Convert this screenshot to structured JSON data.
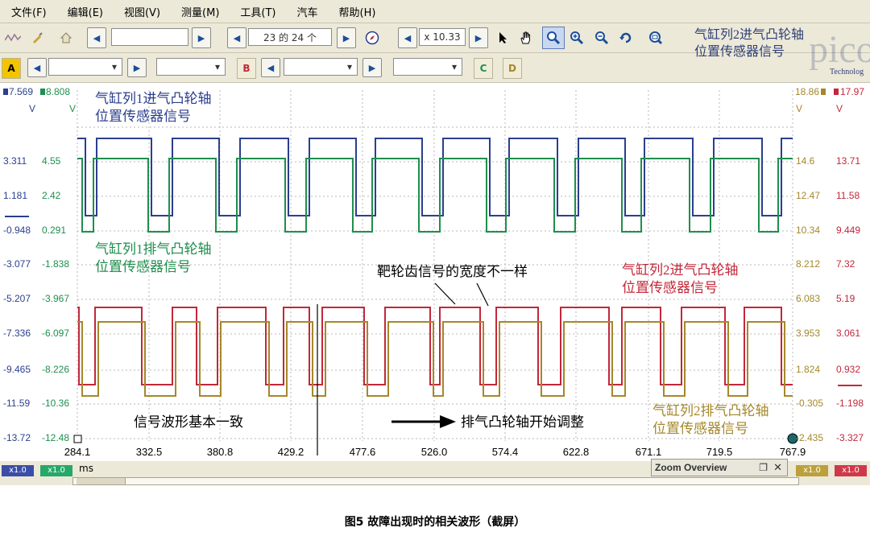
{
  "menu": [
    "文件(F)",
    "编辑(E)",
    "视图(V)",
    "测量(M)",
    "工具(T)",
    "汽车",
    "帮助(H)"
  ],
  "toolbar": {
    "page_counter": "23 的 24 个",
    "zoom_value": "x 10.33"
  },
  "channels": {
    "a": "A",
    "b": "B",
    "c": "C",
    "d": "D"
  },
  "logo": {
    "line1": "气缸列2进气凸轮轴",
    "line2": "位置传感器信号",
    "brand": "pico",
    "sub": "Technolog"
  },
  "axes": {
    "ch_a": {
      "top": "7.569",
      "unit": "V",
      "ticks": [
        "3.311",
        "1.181",
        "-0.948",
        "-3.077",
        "-5.207",
        "-7.336",
        "-9.465",
        "-11.59",
        "-13.72"
      ],
      "color": "#2b3f8e"
    },
    "ch_b": {
      "top": "8.808",
      "unit": "V",
      "ticks": [
        "4.55",
        "2.42",
        "0.291",
        "-1.838",
        "-3.967",
        "-6.097",
        "-8.226",
        "-10.36",
        "-12.48"
      ],
      "color": "#1f8f4e"
    },
    "ch_c": {
      "top": "18.86",
      "unit": "V",
      "ticks": [
        "14.6",
        "12.47",
        "10.34",
        "8.212",
        "6.083",
        "3.953",
        "1.824",
        "-0.305",
        "-2.435"
      ],
      "color": "#a5882a"
    },
    "ch_d": {
      "top": "17.97",
      "unit": "V",
      "ticks": [
        "13.71",
        "11.58",
        "9.449",
        "7.32",
        "5.19",
        "3.061",
        "0.932",
        "-1.198",
        "-3.327"
      ],
      "color": "#c2283a"
    }
  },
  "x_axis": {
    "ticks": [
      "284.1",
      "332.5",
      "380.8",
      "429.2",
      "477.6",
      "526.0",
      "574.4",
      "622.8",
      "671.1",
      "719.5",
      "767.9"
    ],
    "unit": "ms"
  },
  "annotations": {
    "bank1_intake": [
      "气缸列1进气凸轮轴",
      "位置传感器信号"
    ],
    "bank1_exhaust": [
      "气缸列1排气凸轮轴",
      "位置传感器信号"
    ],
    "bank2_intake": [
      "气缸列2进气凸轮轴",
      "位置传感器信号"
    ],
    "bank2_exhaust": [
      "气缸列2排气凸轮轴",
      "位置传感器信号"
    ],
    "tooth_width": "靶轮齿信号的宽度不一样",
    "same_shape": "信号波形基本一致",
    "adjust_start": "排气凸轮轴开始调整"
  },
  "scale_badges": [
    "x1.0",
    "x1.0",
    "x1.0",
    "x1.0"
  ],
  "zoom_overview": "Zoom Overview",
  "caption": "图5   故障出现时的相关波形（截屏）",
  "colors": {
    "blue": "#2b3f8e",
    "green": "#1f8f4e",
    "red": "#c2283a",
    "yellow": "#a5882a"
  }
}
